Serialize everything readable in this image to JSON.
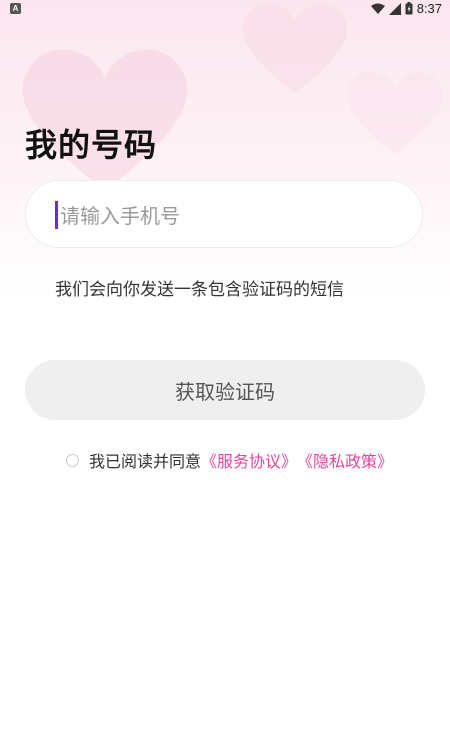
{
  "status_bar": {
    "app_icon": "A",
    "time": "8:37",
    "icons": [
      "wifi-icon",
      "signal-icon",
      "battery-icon"
    ]
  },
  "page": {
    "title": "我的号码"
  },
  "phone": {
    "placeholder": "请输入手机号",
    "value": ""
  },
  "hint": "我们会向你发送一条包含验证码的短信",
  "actions": {
    "get_code_label": "获取验证码"
  },
  "agreement": {
    "checked": false,
    "prefix": "我已阅读并同意",
    "service_label": "《服务协议》",
    "privacy_label": "《隐私政策》"
  },
  "colors": {
    "accent": "#e0479e",
    "caret": "#6a2bd8",
    "button_bg": "#efefef"
  }
}
